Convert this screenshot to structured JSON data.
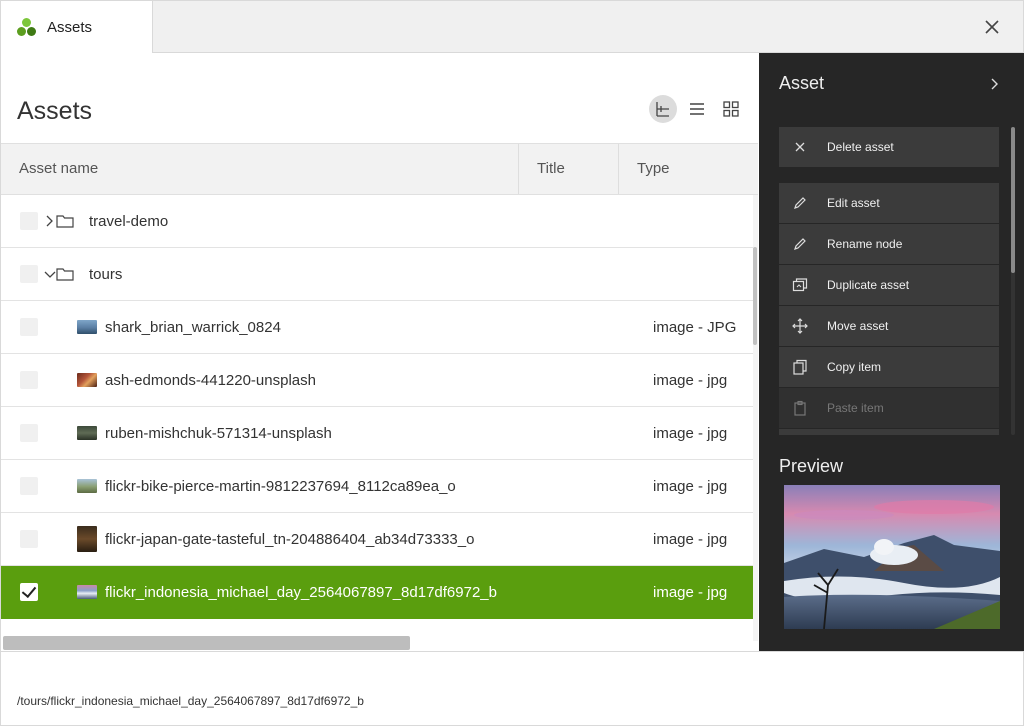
{
  "tab": {
    "label": "Assets",
    "logo_color": "#5a9e0e"
  },
  "window": {
    "close_icon": "close-icon"
  },
  "main": {
    "title": "Assets",
    "view_buttons": [
      "tree-view-icon",
      "list-view-icon",
      "grid-view-icon"
    ],
    "columns": {
      "name": "Asset name",
      "title": "Title",
      "type": "Type"
    }
  },
  "rows": [
    {
      "kind": "folder",
      "name": "travel-demo",
      "expanded": false
    },
    {
      "kind": "folder",
      "name": "tours",
      "expanded": true
    },
    {
      "kind": "asset",
      "name": "shark_brian_warrick_0824",
      "type": "image - JPG"
    },
    {
      "kind": "asset",
      "name": "ash-edmonds-441220-unsplash",
      "type": "image - jpg"
    },
    {
      "kind": "asset",
      "name": "ruben-mishchuk-571314-unsplash",
      "type": "image - jpg"
    },
    {
      "kind": "asset",
      "name": "flickr-bike-pierce-martin-9812237694_8112ca89ea_o",
      "type": "image - jpg"
    },
    {
      "kind": "asset",
      "name": "flickr-japan-gate-tasteful_tn-204886404_ab34d73333_o",
      "type": "image - jpg"
    },
    {
      "kind": "asset",
      "name": "flickr_indonesia_michael_day_2564067897_8d17df6972_b",
      "type": "image - jpg",
      "selected": true
    }
  ],
  "footer": {
    "path": "/tours/flickr_indonesia_michael_day_2564067897_8d17df6972_b"
  },
  "side": {
    "title": "Asset",
    "actions": [
      {
        "label": "Delete asset",
        "icon": "close-icon"
      },
      {
        "label": "Edit asset",
        "icon": "pencil-icon"
      },
      {
        "label": "Rename node",
        "icon": "pencil-icon"
      },
      {
        "label": "Duplicate asset",
        "icon": "duplicate-icon"
      },
      {
        "label": "Move asset",
        "icon": "move-icon"
      },
      {
        "label": "Copy item",
        "icon": "copy-icon"
      },
      {
        "label": "Paste item",
        "icon": "paste-icon",
        "disabled": true
      }
    ],
    "preview_title": "Preview"
  },
  "colors": {
    "accent": "#5a9e0e",
    "side_bg": "#262626",
    "action_bg": "#3b3b3b"
  }
}
